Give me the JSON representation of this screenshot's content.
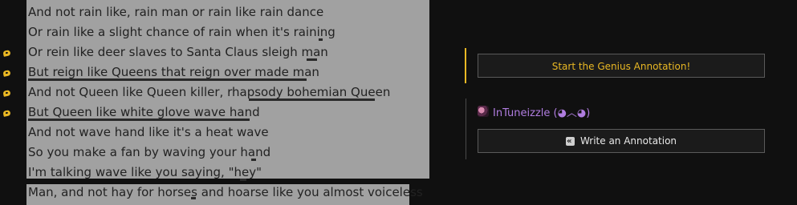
{
  "lyrics": [
    "And not rain like, rain man or rain like rain dance",
    "Or rain like a slight chance of rain when it's raining",
    "Or rein like deer slaves to Santa Claus sleigh man",
    "But reign like Queens that reign over made man",
    "And not Queen like Queen killer, rhapsody bohemian Queen",
    "But Queen like white glove wave hand",
    "And not wave hand like it's a heat wave",
    "So you make a fan by waving your hand",
    "I'm talking wave like you saying, \"hey\"",
    "Man, and not hay for horses and hoarse like you almost voiceless"
  ],
  "annotation_panel": {
    "start_label": "Start the Genius Annotation!",
    "user_name": "InTuneizzle (◕︿◕)",
    "write_label": "Write an Annotation"
  },
  "colors": {
    "accent": "#e9b824",
    "highlight": "#a1a1a1",
    "user": "#b07de0",
    "background": "#101010"
  },
  "icons": {
    "marker": "annotation-marker-icon",
    "write": "annotation-icon",
    "avatar": "avatar"
  }
}
